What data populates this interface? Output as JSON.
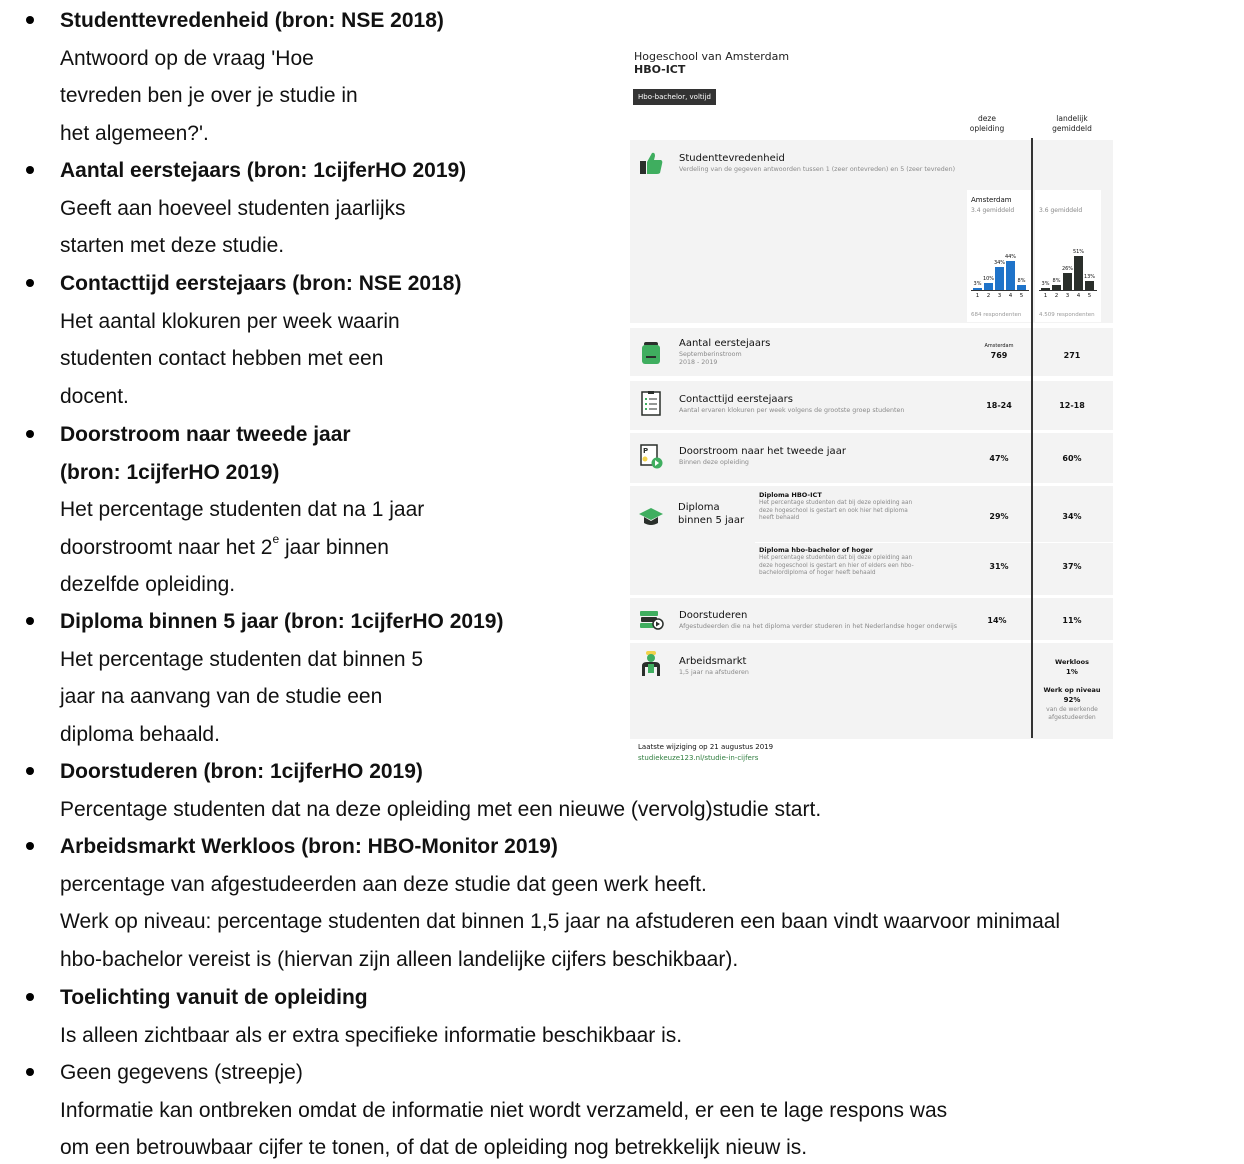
{
  "items": [
    {
      "title": "Studenttevredenheid (bron: NSE 2018)",
      "lines": [
        "Antwoord op de vraag 'Hoe",
        "tevreden ben je over je studie in",
        "het algemeen?'."
      ]
    },
    {
      "title": "Aantal eerstejaars (bron: 1cijferHO 2019)",
      "lines": [
        "Geeft aan hoeveel studenten jaarlijks",
        "starten met deze studie."
      ]
    },
    {
      "title": "Contacttijd eerstejaars (bron: NSE 2018)",
      "lines": [
        "Het aantal klokuren per week waarin",
        "studenten contact hebben met een",
        "docent."
      ]
    },
    {
      "title": "Doorstroom naar tweede jaar",
      "title2": "(bron: 1cijferHO 2019)",
      "lines": [
        "Het percentage studenten dat na 1 jaar"
      ],
      "line_sup": {
        "before": "doorstroomt naar het 2",
        "sup": "e",
        "after": " jaar binnen"
      },
      "lines2": [
        "dezelfde opleiding."
      ]
    },
    {
      "title": "Diploma binnen 5 jaar (bron: 1cijferHO 2019)",
      "lines": [
        "Het percentage studenten dat binnen 5",
        "jaar na aanvang van de studie een",
        "diploma behaald."
      ]
    },
    {
      "title": "Doorstuderen (bron: 1cijferHO 2019)",
      "lines": [
        "Percentage studenten dat na deze opleiding met een nieuwe (vervolg)studie start."
      ]
    },
    {
      "title": "Arbeidsmarkt Werkloos (bron: HBO-Monitor 2019)",
      "lines": [
        "percentage van afgestudeerden aan deze studie dat geen werk heeft.",
        "Werk op niveau: percentage studenten dat binnen 1,5 jaar na afstuderen een baan vindt waarvoor minimaal",
        "hbo-bachelor vereist is (hiervan zijn alleen landelijke cijfers beschikbaar)."
      ]
    },
    {
      "title": "Toelichting vanuit de opleiding",
      "lines": [
        "Is alleen zichtbaar als er extra specifieke informatie beschikbaar is."
      ]
    },
    {
      "plain": "Geen gegevens (streepje)",
      "lines": [
        "Informatie kan ontbreken omdat de informatie niet wordt verzameld, er een te lage respons was",
        "om een betrouwbaar cijfer te tonen, of dat de opleiding nog betrekkelijk nieuw is."
      ]
    }
  ],
  "card": {
    "school": "Hogeschool van Amsterdam",
    "program": "HBO-ICT",
    "tag": "Hbo-bachelor, voltijd",
    "col1": [
      "deze",
      "opleiding"
    ],
    "col2": [
      "landelijk",
      "gemiddeld"
    ],
    "satisfaction": {
      "title": "Studenttevredenheid",
      "sub": "Verdeling van de gegeven antwoorden tussen 1 (zeer ontevreden) en 5 (zeer tevreden)",
      "local": {
        "caption": "Amsterdam",
        "avg": "3.4 gemiddeld",
        "resp": "684 respondenten",
        "values": [
          3,
          10,
          34,
          44,
          8
        ],
        "labels": [
          "3%",
          "10%",
          "34%",
          "44%",
          "8%"
        ]
      },
      "national": {
        "avg": "3.6 gemiddeld",
        "resp": "4.509 respondenten",
        "values": [
          3,
          8,
          26,
          51,
          13
        ],
        "labels": [
          "3%",
          "8%",
          "26%",
          "51%",
          "13%"
        ]
      },
      "ticks": [
        "1",
        "2",
        "3",
        "4",
        "5"
      ]
    },
    "first_year": {
      "title": "Aantal eerstejaars",
      "sub1": "Septemberinstroom",
      "sub2": "2018 - 2019",
      "label": "Amsterdam",
      "local": "769",
      "national": "271"
    },
    "contact": {
      "title": "Contacttijd eerstejaars",
      "sub": "Aantal ervaren klokuren per week volgens de grootste groep studenten",
      "local": "18-24",
      "national": "12-18"
    },
    "flow": {
      "title": "Doorstroom naar het tweede jaar",
      "sub": "Binnen deze opleiding",
      "local": "47%",
      "national": "60%"
    },
    "diploma": {
      "title1": "Diploma",
      "title2": "binnen 5 jaar",
      "a_head": "Diploma HBO-ICT",
      "a_lines": [
        "Het percentage studenten dat bij deze opleiding aan",
        "deze hogeschool is gestart en ook hier het diploma",
        "heeft behaald"
      ],
      "a_local": "29%",
      "a_national": "34%",
      "b_head": "Diploma hbo-bachelor of hoger",
      "b_lines": [
        "Het percentage studenten dat bij deze opleiding aan",
        "deze hogeschool is gestart en hier of elders een hbo-",
        "bachelordiploma of hoger heeft behaald"
      ],
      "b_local": "31%",
      "b_national": "37%"
    },
    "further": {
      "title": "Doorstuderen",
      "sub": "Afgestudeerden die na het diploma verder studeren in het Nederlandse hoger onderwijs",
      "local": "14%",
      "national": "11%"
    },
    "labour": {
      "title": "Arbeidsmarkt",
      "sub": "1,5 jaar na afstuderen",
      "unemp_label": "Werkloos",
      "unemp": "1%",
      "level_label": "Werk op niveau",
      "level": "92%",
      "level_sub1": "van de werkende",
      "level_sub2": "afgestudeerden"
    },
    "footer": {
      "updated": "Laatste wijziging op 21 augustus 2019",
      "link": "studiekeuze123.nl/studie-in-cijfers"
    }
  },
  "colors": {
    "local_bar": "#1f73c9",
    "national_bar": "#2a2f2b",
    "accent_green": "#3fae5f"
  }
}
